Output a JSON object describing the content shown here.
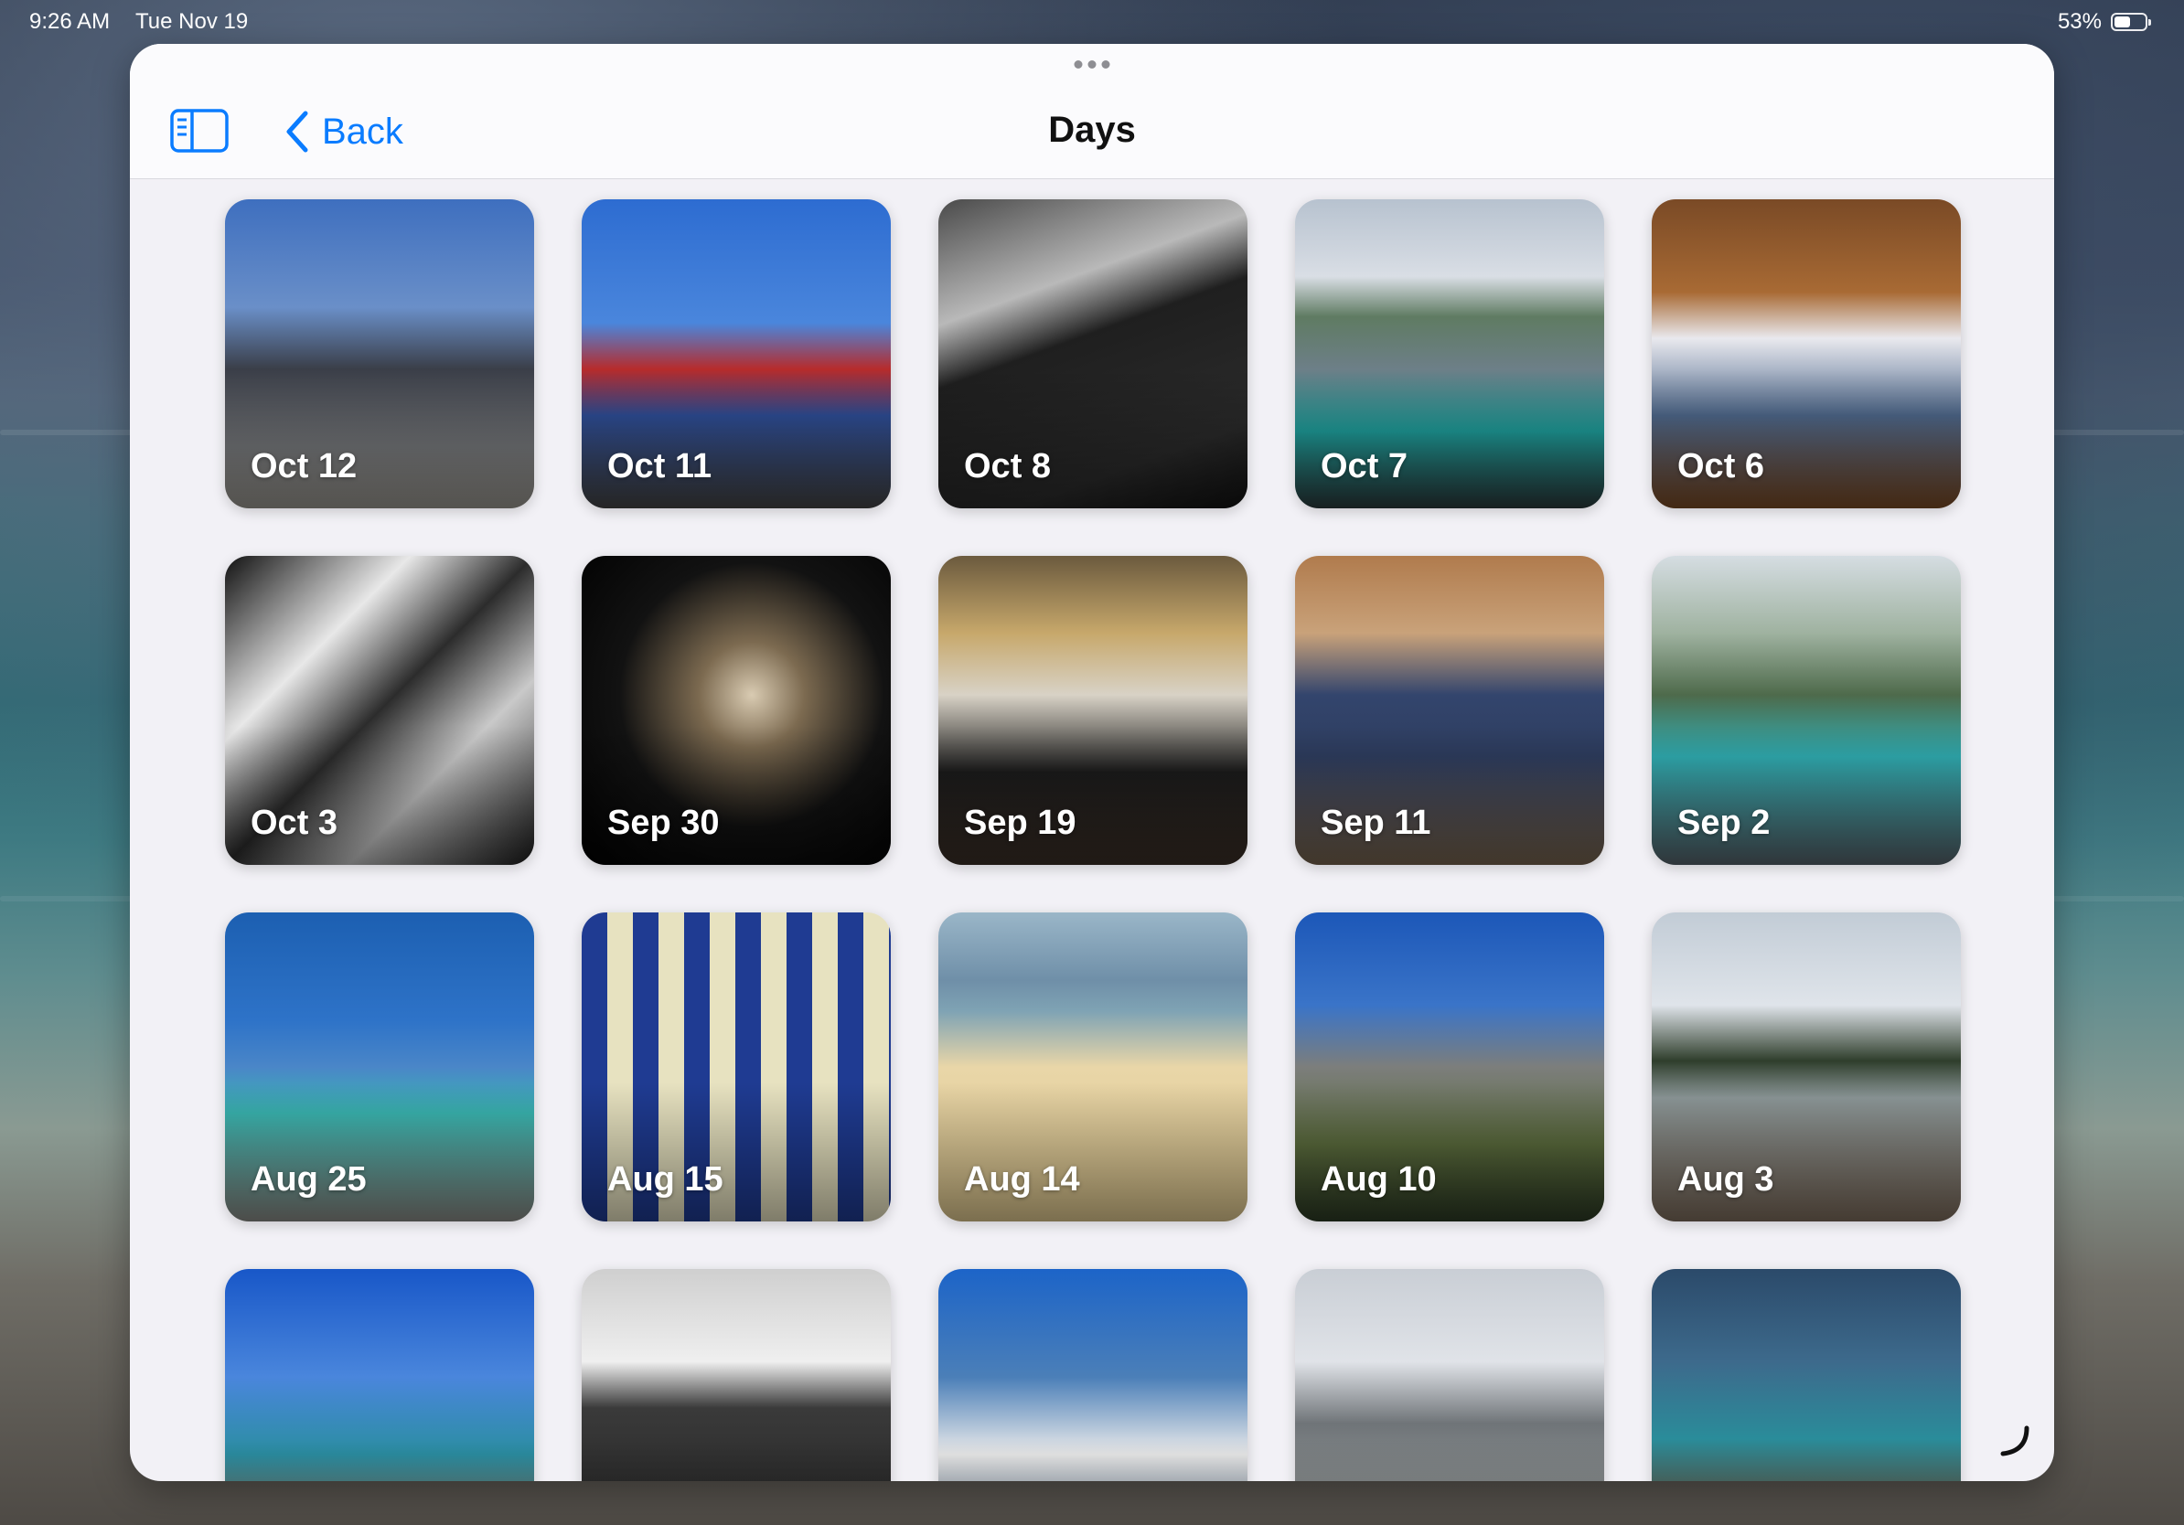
{
  "status_bar": {
    "time": "9:26 AM",
    "date": "Tue Nov 19",
    "battery_percent": "53%",
    "battery_level": 0.53
  },
  "header": {
    "back_label": "Back",
    "title": "Days"
  },
  "icons": {
    "sidebar": "sidebar-toggle-icon",
    "back": "chevron-left-icon",
    "resize": "resize-corner-icon"
  },
  "colors": {
    "accent": "#0a7cff",
    "window_bg": "#f2f1f6",
    "header_bg": "#fbfbfd"
  },
  "days": [
    {
      "label": "Oct 12",
      "bg": "linear-gradient(180deg,#3e6fbf 0%,#6a8fc8 35%,#3a3e48 55%,#7b7d80 80%,#9a9790 100%)"
    },
    {
      "label": "Oct 11",
      "bg": "linear-gradient(180deg,#2d6cd1 0%,#4a86dc 40%,#b72b2b 55%,#2f4f9a 70%,#444 100%)"
    },
    {
      "label": "Oct 8",
      "bg": "linear-gradient(160deg,#4a4a4a 0%,#b9b9b9 30%,#1f1f1f 45%,#2b2b2b 80%,#111 100%)"
    },
    {
      "label": "Oct 7",
      "bg": "linear-gradient(180deg,#b7c2cf 0%,#d9dee5 25%,#5f7b62 38%,#6d7f88 55%,#1fa3a0 75%,#2b3a3c 100%)"
    },
    {
      "label": "Oct 6",
      "bg": "linear-gradient(180deg,#7a4a26 0%,#a86a34 30%,#e9e9ee 45%,#506a8e 70%,#7a4a24 100%)"
    },
    {
      "label": "Oct 3",
      "bg": "linear-gradient(135deg,#101010 0%,#e8e8e8 30%,#2c2c2c 50%,#c9c9c9 70%,#1a1a1a 100%)"
    },
    {
      "label": "Sep 30",
      "bg": "radial-gradient(circle at 55% 45%,#d9cbb2 0%,#7c6a50 22%,#121212 55%,#000 100%)"
    },
    {
      "label": "Sep 19",
      "bg": "linear-gradient(180deg,#6b5a3e 0%,#c7a86b 25%,#d8d2c6 45%,#1b1b1b 70%,#3a2e26 100%)"
    },
    {
      "label": "Sep 11",
      "bg": "linear-gradient(180deg,#b07b4d 0%,#c9a27a 25%,#33456d 45%,#2e3d5f 65%,#77644e 100%)"
    },
    {
      "label": "Sep 2",
      "bg": "linear-gradient(180deg,#d5dde2 0%,#9fb2a0 25%,#4e6a4b 45%,#30aeb3 65%,#56636b 100%)"
    },
    {
      "label": "Aug 25",
      "bg": "linear-gradient(180deg,#1c5fb1 0%,#2e73c8 35%,#4a86c8 50%,#3ab7b2 65%,#8b8b86 100%)"
    },
    {
      "label": "Aug 15",
      "bg": "repeating-linear-gradient(90deg,#1f3b92 0px,#1f3b92 28px,#e7e2c0 28px,#e7e2c0 56px)"
    },
    {
      "label": "Aug 14",
      "bg": "linear-gradient(180deg,#9ab6c8 0%,#6f8fa8 22%,#7fa3b4 32%,#e9d6a8 50%,#e0c98f 100%)"
    },
    {
      "label": "Aug 10",
      "bg": "linear-gradient(180deg,#1c57b8 0%,#3a74c8 30%,#7c7e7c 50%,#5d6e3e 75%,#2c3a24 100%)"
    },
    {
      "label": "Aug 3",
      "bg": "linear-gradient(180deg,#c2ccd6 0%,#dfe4ea 30%,#2f3e2c 48%,#8d9899 60%,#7d6c5c 100%)"
    },
    {
      "label": "",
      "bg": "linear-gradient(180deg,#1857c8 0%,#4a86dc 35%,#2b8ea2 60%,#777a6c 80%,#5b5b50 100%)"
    },
    {
      "label": "",
      "bg": "linear-gradient(180deg,#cfcfcf 0%,#efefef 30%,#3a3a3a 45%,#1c1c1c 100%)"
    },
    {
      "label": "",
      "bg": "linear-gradient(180deg,#1c64c8 0%,#4b7fb8 35%,#eaeaea 60%,#2c4e72 100%)"
    },
    {
      "label": "",
      "bg": "linear-gradient(180deg,#c9ced5 0%,#e0e3e8 30%,#6f7478 50%,#9a9f9f 80%,#7d7f7c 100%)"
    },
    {
      "label": "",
      "bg": "linear-gradient(180deg,#2b4a6a 0%,#3d6a8c 30%,#2a8c9a 55%,#6b5a44 80%,#4a3a2c 100%)"
    }
  ]
}
